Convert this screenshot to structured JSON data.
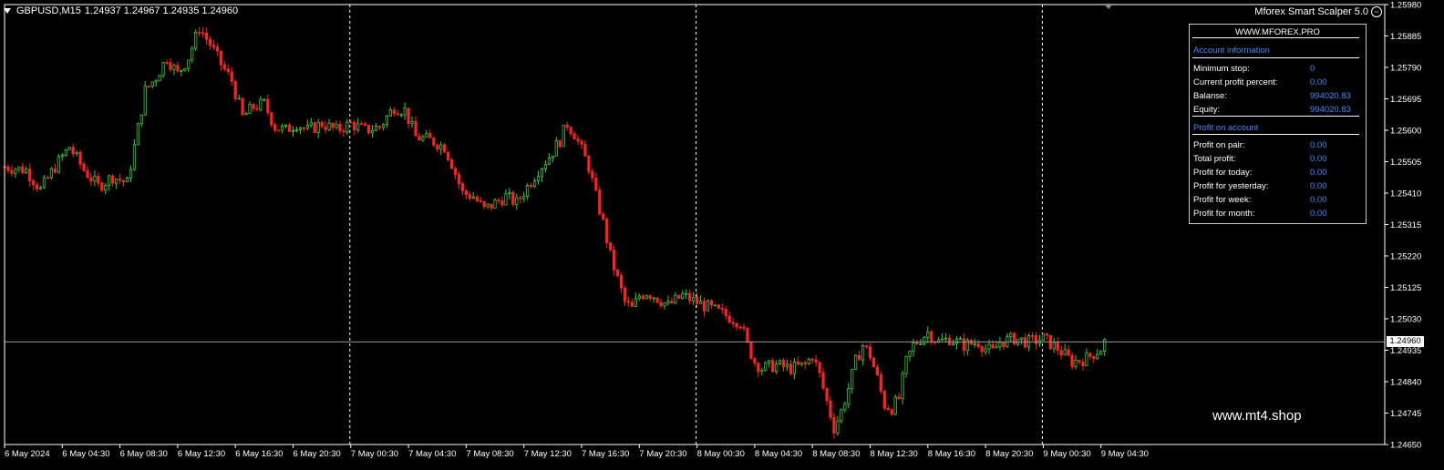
{
  "chart_window": {
    "symbol_label": "GBPUSD,M15",
    "ohlc_text": "1.24937 1.24967 1.24935 1.24960",
    "ea_name": "Mforex Smart Scalper 5.0",
    "current_price_tag": "1.24960",
    "watermark": "www.mt4.shop",
    "colors": {
      "background": "#000000",
      "bull_candle": "#32cd32",
      "bear_candle": "#ff2020",
      "axis": "#ffffff",
      "panel_accent": "#3d8bff"
    }
  },
  "info_panel": {
    "site": "WWW.MFOREX.PRO",
    "account_section": "Account information",
    "account_rows": [
      {
        "label": "Minimum stop:",
        "value": "0"
      },
      {
        "label": "Current profit percent:",
        "value": "0.00"
      },
      {
        "label": "Balanse:",
        "value": "994020.83"
      },
      {
        "label": "Equity:",
        "value": "994020.83"
      }
    ],
    "profit_section": "Profit on account",
    "profit_rows": [
      {
        "label": "Profit on pair:",
        "value": "0.00"
      },
      {
        "label": "Total profit:",
        "value": "0.00"
      },
      {
        "label": "Profit for today:",
        "value": "0.00"
      },
      {
        "label": "Profit for yesterday:",
        "value": "0.00"
      },
      {
        "label": "Profit for week:",
        "value": "0.00"
      },
      {
        "label": "Profit for month:",
        "value": "0.00"
      }
    ]
  },
  "chart_data": {
    "type": "candlestick",
    "symbol": "GBPUSD",
    "timeframe": "M15",
    "ylim": [
      1.2465,
      1.2598
    ],
    "y_ticks": [
      "1.25980",
      "1.25885",
      "1.25790",
      "1.25695",
      "1.25600",
      "1.25505",
      "1.25410",
      "1.25315",
      "1.25220",
      "1.25125",
      "1.25030",
      "1.24935",
      "1.24840",
      "1.24745",
      "1.24650"
    ],
    "x_ticks": [
      "6 May 2024",
      "6 May 04:30",
      "6 May 08:30",
      "6 May 12:30",
      "6 May 16:30",
      "6 May 20:30",
      "7 May 00:30",
      "7 May 04:30",
      "7 May 08:30",
      "7 May 12:30",
      "7 May 16:30",
      "7 May 20:30",
      "8 May 00:30",
      "8 May 04:30",
      "8 May 08:30",
      "8 May 12:30",
      "8 May 16:30",
      "8 May 20:30",
      "9 May 00:30",
      "9 May 04:30"
    ],
    "day_separators": [
      "7 May 00:00",
      "8 May 00:00",
      "9 May 00:00"
    ],
    "current_price": 1.2496,
    "close_path": [
      [
        "6 May 00:00",
        1.2549
      ],
      [
        "6 May 01:30",
        1.2548
      ],
      [
        "6 May 02:30",
        1.2542
      ],
      [
        "6 May 03:30",
        1.2549
      ],
      [
        "6 May 04:30",
        1.2555
      ],
      [
        "6 May 05:30",
        1.2548
      ],
      [
        "6 May 06:30",
        1.2543
      ],
      [
        "6 May 07:30",
        1.2546
      ],
      [
        "6 May 08:30",
        1.2544
      ],
      [
        "6 May 09:00",
        1.2555
      ],
      [
        "6 May 09:45",
        1.2572
      ],
      [
        "6 May 10:30",
        1.2576
      ],
      [
        "6 May 11:15",
        1.2582
      ],
      [
        "6 May 12:00",
        1.2577
      ],
      [
        "6 May 12:45",
        1.2582
      ],
      [
        "6 May 13:30",
        1.2591
      ],
      [
        "6 May 14:15",
        1.2586
      ],
      [
        "6 May 15:00",
        1.258
      ],
      [
        "6 May 15:45",
        1.2575
      ],
      [
        "6 May 16:30",
        1.2564
      ],
      [
        "6 May 17:15",
        1.2567
      ],
      [
        "6 May 18:00",
        1.2568
      ],
      [
        "6 May 18:45",
        1.2561
      ],
      [
        "6 May 19:30",
        1.256
      ],
      [
        "6 May 20:15",
        1.2562
      ],
      [
        "6 May 21:00",
        1.256
      ],
      [
        "6 May 22:00",
        1.2562
      ],
      [
        "6 May 23:00",
        1.256
      ],
      [
        "7 May 00:00",
        1.2562
      ],
      [
        "7 May 01:00",
        1.256
      ],
      [
        "7 May 02:00",
        1.2561
      ],
      [
        "7 May 03:00",
        1.2567
      ],
      [
        "7 May 03:45",
        1.2566
      ],
      [
        "7 May 04:30",
        1.2558
      ],
      [
        "7 May 05:30",
        1.2557
      ],
      [
        "7 May 06:30",
        1.2555
      ],
      [
        "7 May 07:00",
        1.255
      ],
      [
        "7 May 07:45",
        1.2541
      ],
      [
        "7 May 08:30",
        1.254
      ],
      [
        "7 May 09:15",
        1.2536
      ],
      [
        "7 May 10:00",
        1.2538
      ],
      [
        "7 May 10:45",
        1.254
      ],
      [
        "7 May 11:30",
        1.2538
      ],
      [
        "7 May 12:15",
        1.2543
      ],
      [
        "7 May 13:00",
        1.2548
      ],
      [
        "7 May 13:45",
        1.2552
      ],
      [
        "7 May 14:30",
        1.2557
      ],
      [
        "7 May 15:00",
        1.2562
      ],
      [
        "7 May 15:30",
        1.2559
      ],
      [
        "7 May 16:00",
        1.2554
      ],
      [
        "7 May 16:30",
        1.2549
      ],
      [
        "7 May 17:00",
        1.254
      ],
      [
        "7 May 17:30",
        1.2532
      ],
      [
        "7 May 18:00",
        1.2522
      ],
      [
        "7 May 18:30",
        1.2515
      ],
      [
        "7 May 19:00",
        1.2508
      ],
      [
        "7 May 19:30",
        1.2506
      ],
      [
        "7 May 20:00",
        1.251
      ],
      [
        "7 May 20:30",
        1.2511
      ],
      [
        "7 May 21:00",
        1.251
      ],
      [
        "7 May 22:00",
        1.2507
      ],
      [
        "7 May 23:00",
        1.251
      ],
      [
        "8 May 00:00",
        1.2508
      ],
      [
        "8 May 01:00",
        1.2506
      ],
      [
        "8 May 02:00",
        1.2504
      ],
      [
        "8 May 03:00",
        1.2502
      ],
      [
        "8 May 03:30",
        1.2495
      ],
      [
        "8 May 04:00",
        1.249
      ],
      [
        "8 May 04:30",
        1.2488
      ],
      [
        "8 May 05:30",
        1.2489
      ],
      [
        "8 May 06:30",
        1.2488
      ],
      [
        "8 May 07:30",
        1.2489
      ],
      [
        "8 May 08:00",
        1.2492
      ],
      [
        "8 May 08:30",
        1.2486
      ],
      [
        "8 May 09:00",
        1.2478
      ],
      [
        "8 May 09:30",
        1.247
      ],
      [
        "8 May 10:00",
        1.2475
      ],
      [
        "8 May 10:30",
        1.2482
      ],
      [
        "8 May 11:00",
        1.249
      ],
      [
        "8 May 11:30",
        1.2495
      ],
      [
        "8 May 12:00",
        1.2492
      ],
      [
        "8 May 12:30",
        1.2485
      ],
      [
        "8 May 13:00",
        1.2477
      ],
      [
        "8 May 13:30",
        1.2476
      ],
      [
        "8 May 14:00",
        1.2479
      ],
      [
        "8 May 14:30",
        1.249
      ],
      [
        "8 May 15:00",
        1.2495
      ],
      [
        "8 May 15:30",
        1.2497
      ],
      [
        "8 May 16:00",
        1.2499
      ],
      [
        "8 May 16:45",
        1.2496
      ],
      [
        "8 May 17:30",
        1.2497
      ],
      [
        "8 May 18:30",
        1.2495
      ],
      [
        "8 May 19:30",
        1.2496
      ],
      [
        "8 May 20:00",
        1.2494
      ],
      [
        "8 May 20:30",
        1.2493
      ],
      [
        "8 May 21:00",
        1.2496
      ],
      [
        "8 May 22:00",
        1.2497
      ],
      [
        "8 May 23:00",
        1.2496
      ],
      [
        "9 May 00:00",
        1.2497
      ],
      [
        "9 May 01:00",
        1.2494
      ],
      [
        "9 May 02:00",
        1.249
      ],
      [
        "9 May 03:00",
        1.2491
      ],
      [
        "9 May 04:00",
        1.2494
      ],
      [
        "9 May 04:15",
        1.2496
      ]
    ]
  }
}
